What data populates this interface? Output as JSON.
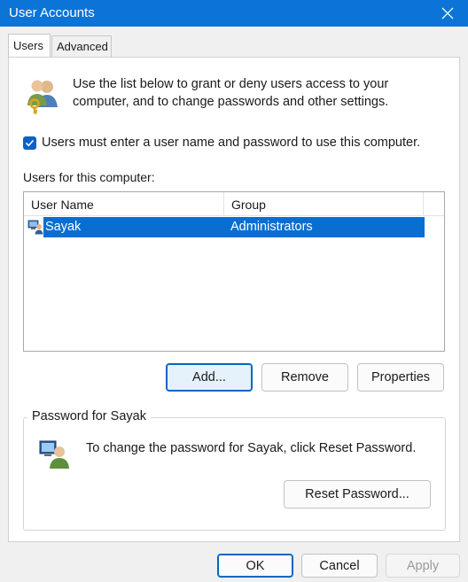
{
  "window": {
    "title": "User Accounts",
    "close_icon": "close-icon"
  },
  "tabs": [
    {
      "label": "Users",
      "active": true
    },
    {
      "label": "Advanced",
      "active": false
    }
  ],
  "intro": {
    "icon": "users-key-icon",
    "text": "Use the list below to grant or deny users access to your computer, and to change passwords and other settings."
  },
  "require_login": {
    "checked": true,
    "label": "Users must enter a user name and password to use this computer."
  },
  "users_list": {
    "label": "Users for this computer:",
    "columns": [
      "User Name",
      "Group"
    ],
    "rows": [
      {
        "icon": "user-computer-icon",
        "name": "Sayak",
        "group": "Administrators",
        "selected": true
      }
    ]
  },
  "user_buttons": {
    "add": "Add...",
    "remove": "Remove",
    "properties": "Properties"
  },
  "password_group": {
    "legend": "Password for Sayak",
    "icon": "user-password-icon",
    "text": "To change the password for Sayak, click Reset Password.",
    "reset_button": "Reset Password..."
  },
  "dialog_buttons": {
    "ok": "OK",
    "cancel": "Cancel",
    "apply": "Apply",
    "apply_enabled": false
  },
  "colors": {
    "titlebar": "#0b74d6",
    "selection": "#0a6ed1",
    "accent": "#0067c0"
  }
}
